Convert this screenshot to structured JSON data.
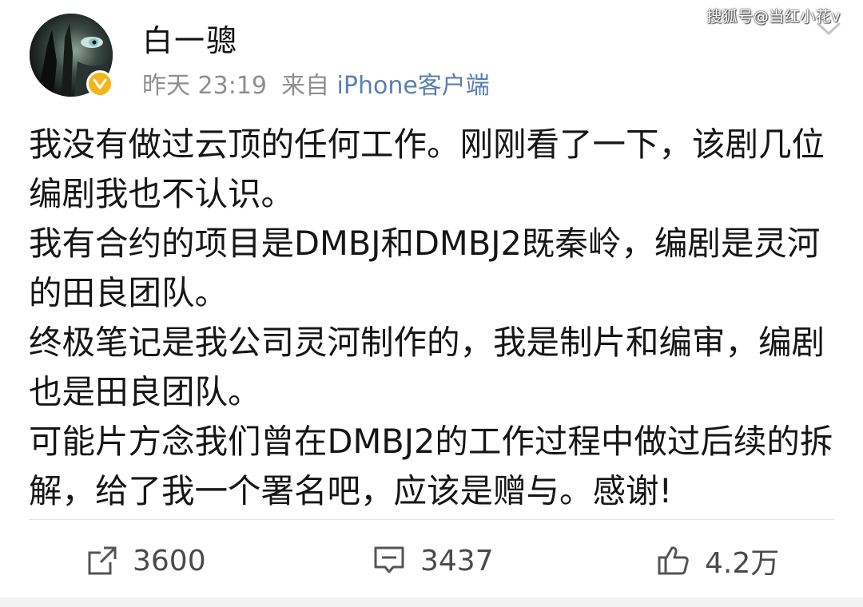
{
  "watermark": "搜狐号@当红小花v",
  "post": {
    "author": "白一骢",
    "verified_badge": "V",
    "time": "昨天 23:19",
    "source_prefix": "来自",
    "source": "iPhone客户端",
    "paragraphs": [
      "我没有做过云顶的任何工作。刚刚看了一下，该剧几位编剧我也不认识。",
      "我有合约的项目是DMBJ和DMBJ2既秦岭，编剧是灵河的田良团队。",
      "终极笔记是我公司灵河制作的，我是制片和编审，编剧也是田良团队。",
      "可能片方念我们曾在DMBJ2的工作过程中做过后续的拆解，给了我一个署名吧，应该是赠与。感谢!"
    ]
  },
  "actions": {
    "repost_count": "3600",
    "comment_count": "3437",
    "like_count": "4.2万"
  },
  "icons": {
    "repost": "share-icon",
    "comment": "comment-icon",
    "like": "thumbs-up-icon",
    "menu": "chevron-down-icon",
    "verified": "verified-v-icon"
  },
  "colors": {
    "text": "#161616",
    "meta": "#8f8f8f",
    "source_link": "#5b7fb3",
    "verified": "#f5b41a"
  }
}
